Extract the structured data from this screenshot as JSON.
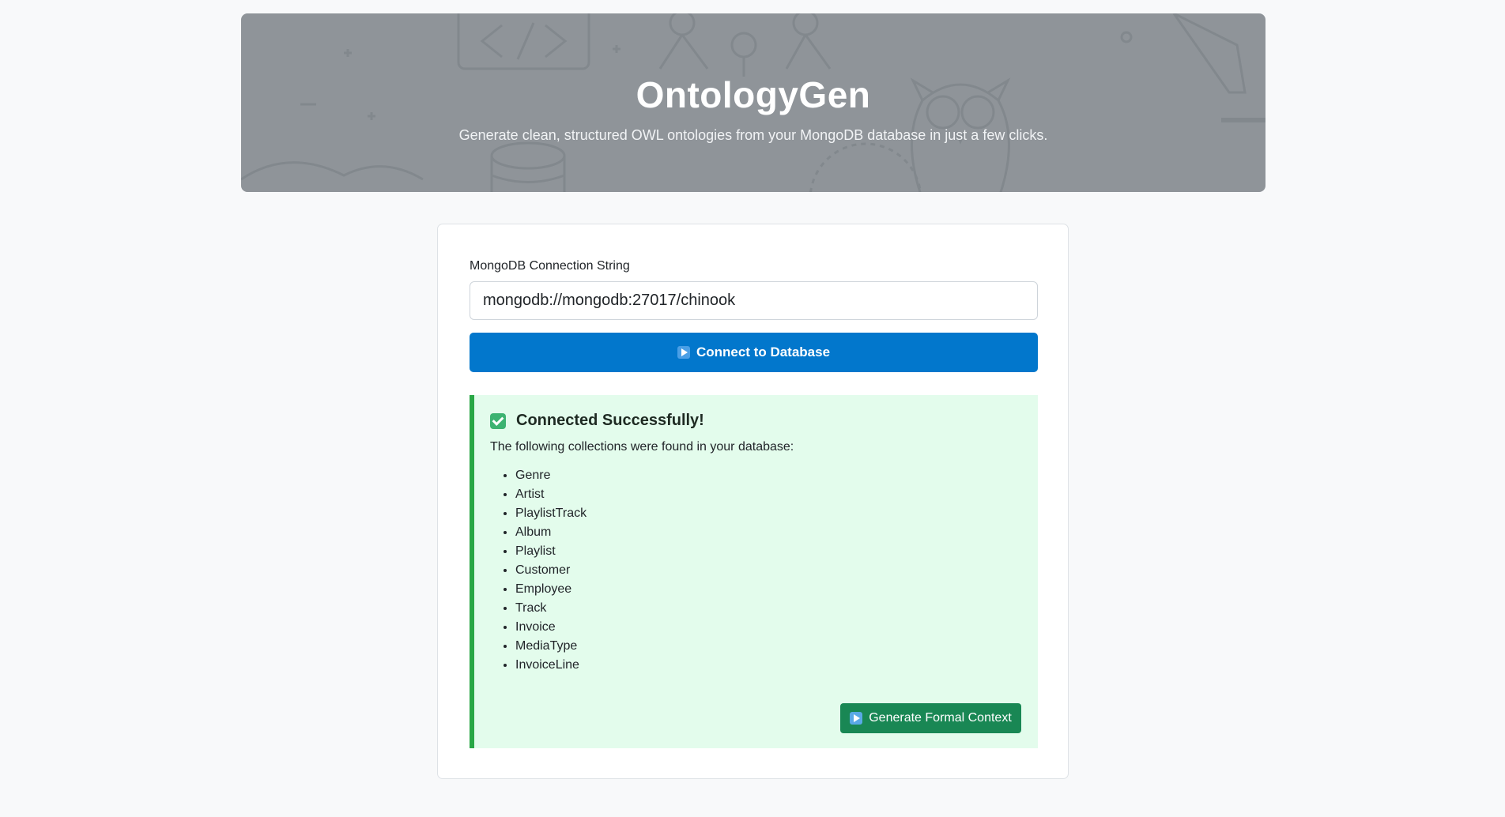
{
  "header": {
    "title": "OntologyGen",
    "subtitle": "Generate clean, structured OWL ontologies from your MongoDB database in just a few clicks."
  },
  "connection": {
    "label": "MongoDB Connection String",
    "value": "mongodb://mongodb:27017/chinook",
    "connect_button": "Connect to Database",
    "connect_icon": "play-icon"
  },
  "result": {
    "icon": "check-icon",
    "title": "Connected Successfully!",
    "description": "The following collections were found in your database:",
    "collections": [
      "Genre",
      "Artist",
      "PlaylistTrack",
      "Album",
      "Playlist",
      "Customer",
      "Employee",
      "Track",
      "Invoice",
      "MediaType",
      "InvoiceLine"
    ],
    "generate_button": "Generate Formal Context",
    "generate_icon": "play-icon"
  },
  "colors": {
    "primary": "#0277cc",
    "success": "#198754",
    "success_bg": "#e3fcec",
    "success_border": "#28a745",
    "header_bg": "#8f9499"
  }
}
